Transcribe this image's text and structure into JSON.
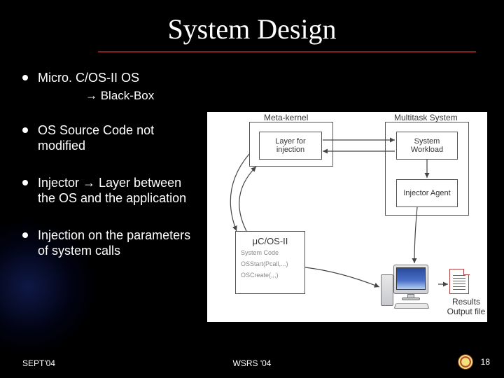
{
  "title": "System Design",
  "bullets": {
    "b1": "Micro. C/OS-II OS",
    "b1sub": "→ Black-Box",
    "b2": "OS Source Code not modified",
    "b3": "Injector → Layer between the OS and the  application",
    "b4": "Injection on the parameters of system calls"
  },
  "figure": {
    "meta_kernel": "Meta-kernel",
    "layer_injection": "Layer for injection",
    "multitask_system": "Multitask System",
    "system_workload": "System Workload",
    "injector_agent": "Injector Agent",
    "ucos_title": "μC/OS-II",
    "ucos_l1": "System Code",
    "ucos_l2": "OSStart(Pcall,...)",
    "ucos_l3": "OSCreate(,,,)",
    "results_label": "Results Output file"
  },
  "footer": {
    "left": "SEPT'04",
    "center": "WSRS '04",
    "page": "18"
  }
}
